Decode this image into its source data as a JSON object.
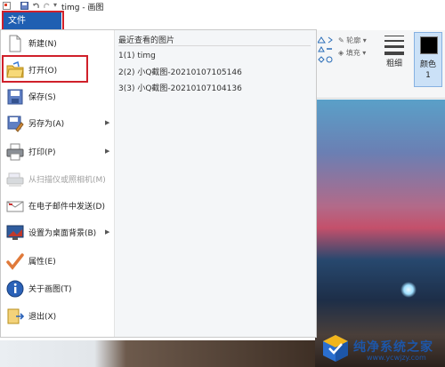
{
  "window": {
    "title": "timg - 画图"
  },
  "file_tab": {
    "label": "文件"
  },
  "menu": {
    "items": [
      {
        "label": "新建(N)",
        "icon": "new-document-icon",
        "disabled": false,
        "submenu": false
      },
      {
        "label": "打开(O)",
        "icon": "open-folder-icon",
        "disabled": false,
        "submenu": false
      },
      {
        "label": "保存(S)",
        "icon": "save-icon",
        "disabled": false,
        "submenu": false
      },
      {
        "label": "另存为(A)",
        "icon": "save-as-icon",
        "disabled": false,
        "submenu": true
      },
      {
        "label": "打印(P)",
        "icon": "printer-icon",
        "disabled": false,
        "submenu": true
      },
      {
        "label": "从扫描仪或照相机(M)",
        "icon": "scanner-icon",
        "disabled": true,
        "submenu": false
      },
      {
        "label": "在电子邮件中发送(D)",
        "icon": "email-icon",
        "disabled": false,
        "submenu": false
      },
      {
        "label": "设置为桌面背景(B)",
        "icon": "desktop-background-icon",
        "disabled": false,
        "submenu": true
      },
      {
        "label": "属性(E)",
        "icon": "checkmark-icon",
        "disabled": false,
        "submenu": false
      },
      {
        "label": "关于画图(T)",
        "icon": "info-icon",
        "disabled": false,
        "submenu": false
      },
      {
        "label": "退出(X)",
        "icon": "exit-icon",
        "disabled": false,
        "submenu": false
      }
    ],
    "recent": {
      "title": "最近查看的图片",
      "items": [
        "1(1)  timg",
        "2(2)  小Q截图-20210107105146",
        "3(3)  小Q截图-20210107104136"
      ]
    }
  },
  "ribbon": {
    "outline_label": "轮廓",
    "fill_label": "填充",
    "size_label": "粗细",
    "color_label": "颜色1"
  },
  "watermark": {
    "title": "纯净系统之家",
    "url": "www.ycwjzy.com"
  },
  "colors": {
    "file_tab": "#1f5fb2",
    "highlight_outline": "#d0202a",
    "watermark": "#1d56a8"
  }
}
